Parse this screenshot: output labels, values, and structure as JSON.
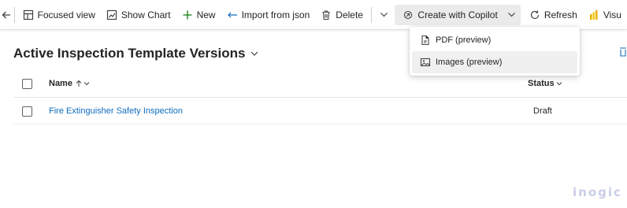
{
  "toolbar": {
    "back_icon": "arrow-left-icon",
    "focused_view": "Focused view",
    "show_chart": "Show Chart",
    "new": "New",
    "import_json": "Import from json",
    "delete": "Delete",
    "create_copilot": "Create with Copilot",
    "refresh": "Refresh",
    "visualize_truncated": "Visu"
  },
  "dropdown": {
    "items": [
      {
        "label": "PDF (preview)",
        "icon": "pdf-document-icon"
      },
      {
        "label": "Images (preview)",
        "icon": "image-icon"
      }
    ]
  },
  "view": {
    "title": "Active Inspection Template Versions"
  },
  "grid": {
    "columns": [
      {
        "label": "Name",
        "sort": "ascending"
      },
      {
        "label": "Status"
      }
    ],
    "rows": [
      {
        "name": "Fire Extinguisher Safety Inspection",
        "status": "Draft"
      }
    ]
  },
  "watermark": "inogic",
  "colors": {
    "link": "#0f6cbd",
    "active_button_bg": "#ebebeb",
    "hover_item_bg": "#f0f0f0"
  }
}
